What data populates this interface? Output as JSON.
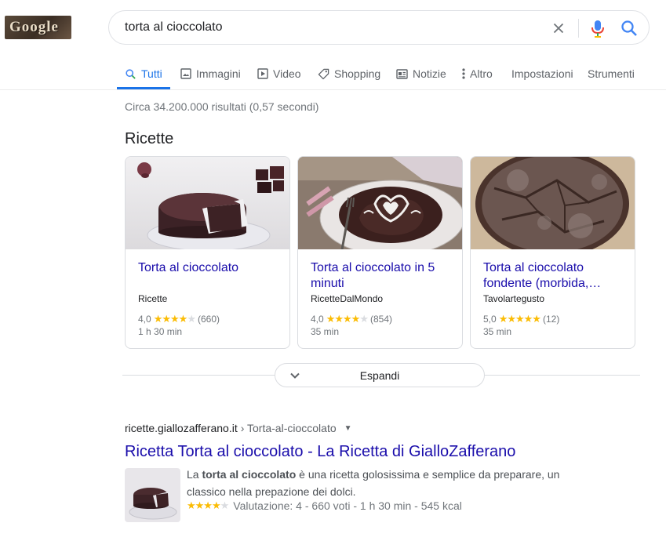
{
  "logo": {
    "text": "Google"
  },
  "search": {
    "query": "torta al cioccolato"
  },
  "tabs": [
    {
      "label": "Tutti",
      "icon": "search-icon"
    },
    {
      "label": "Immagini",
      "icon": "image-icon"
    },
    {
      "label": "Video",
      "icon": "video-icon"
    },
    {
      "label": "Shopping",
      "icon": "tag-icon"
    },
    {
      "label": "Notizie",
      "icon": "news-icon"
    },
    {
      "label": "Altro",
      "icon": "more-vertical-icon"
    },
    {
      "label": "Impostazioni"
    },
    {
      "label": "Strumenti"
    }
  ],
  "stats": "Circa 34.200.000 risultati (0,57 secondi)",
  "recipes": {
    "title": "Ricette",
    "cards": [
      {
        "title": "Torta al cioccolato",
        "source": "Ricette",
        "rating": "4,0",
        "rating_value": 4,
        "reviews": "(660)",
        "time": "1 h 30 min"
      },
      {
        "title": "Torta al cioccolato in 5 minuti",
        "source": "RicetteDalMondo",
        "rating": "4,0",
        "rating_value": 4,
        "reviews": "(854)",
        "time": "35 min"
      },
      {
        "title": "Torta al cioccolato fondente (morbida,…",
        "source": "Tavolartegusto",
        "rating": "5,0",
        "rating_value": 5,
        "reviews": "(12)",
        "time": "35 min"
      }
    ],
    "expand_label": "Espandi"
  },
  "result": {
    "domain": "ricette.giallozafferano.it",
    "path": " › Torta-al-cioccolato",
    "title": "Ricetta Torta al cioccolato - La Ricetta di GialloZafferano",
    "snippet_pre": "La ",
    "snippet_bold": "torta al cioccolato",
    "snippet_post": " è una ricetta golosissima e semplice da preparare, un classico nella prepazione dei dolci.",
    "rating_value": 4,
    "rating_text": "Valutazione: 4 - 660 voti - 1 h 30 min - 545 kcal"
  },
  "colors": {
    "accent": "#1a73e8",
    "link": "#1a0dab",
    "star": "#fbbc04"
  }
}
